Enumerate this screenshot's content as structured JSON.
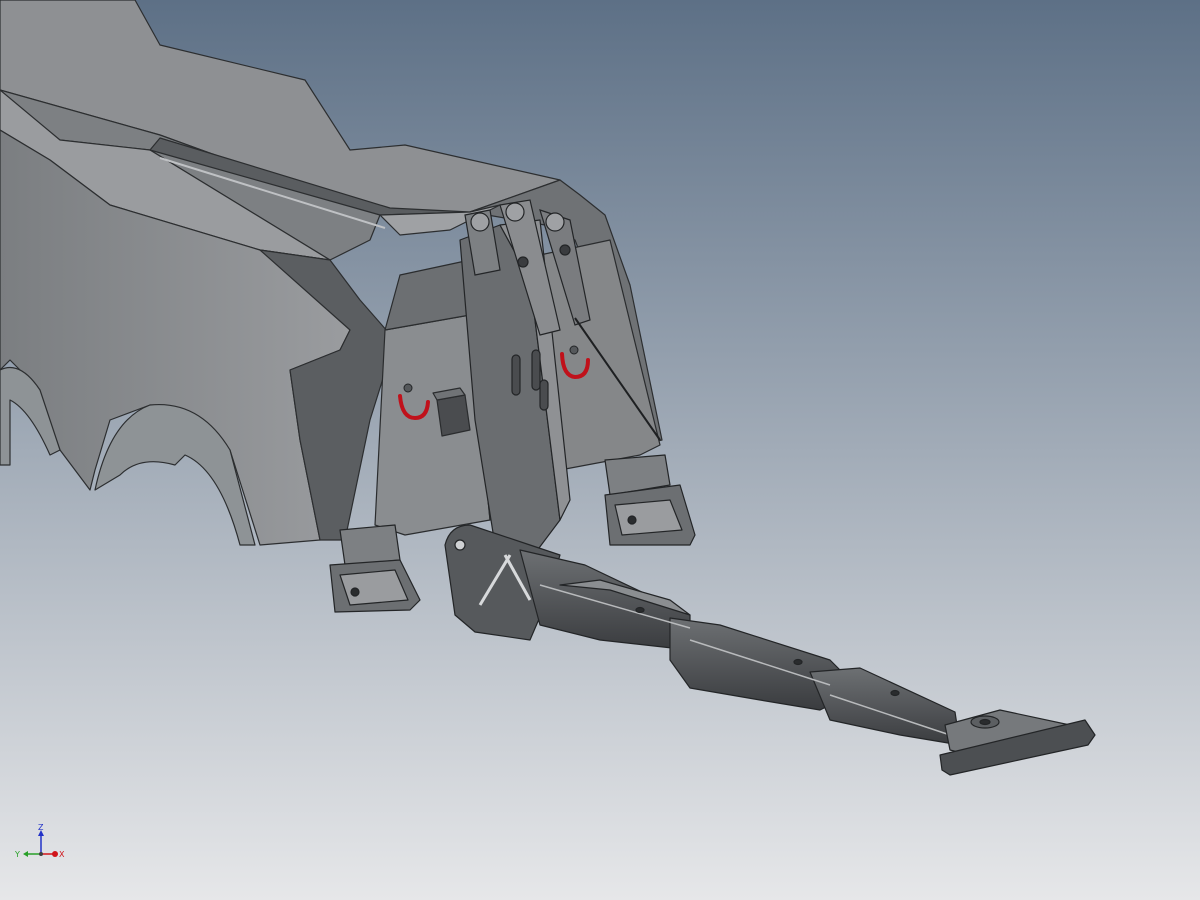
{
  "viewport": {
    "background_top": "#5d7086",
    "background_bottom": "#e6e7e9"
  },
  "model": {
    "body_light": "#8b8d90",
    "body_mid": "#707376",
    "body_dark": "#55585b",
    "body_edge": "#2c2e30",
    "steel_dark": "#3c3e41",
    "steel_light": "#9c9ea1",
    "shackle_color": "#c0111b"
  },
  "view_cube_triad": {
    "x_label": "X",
    "y_label": "Y",
    "z_label": "Z",
    "x_color": "#d0141a",
    "y_color": "#28a028",
    "z_color": "#2232c8"
  }
}
